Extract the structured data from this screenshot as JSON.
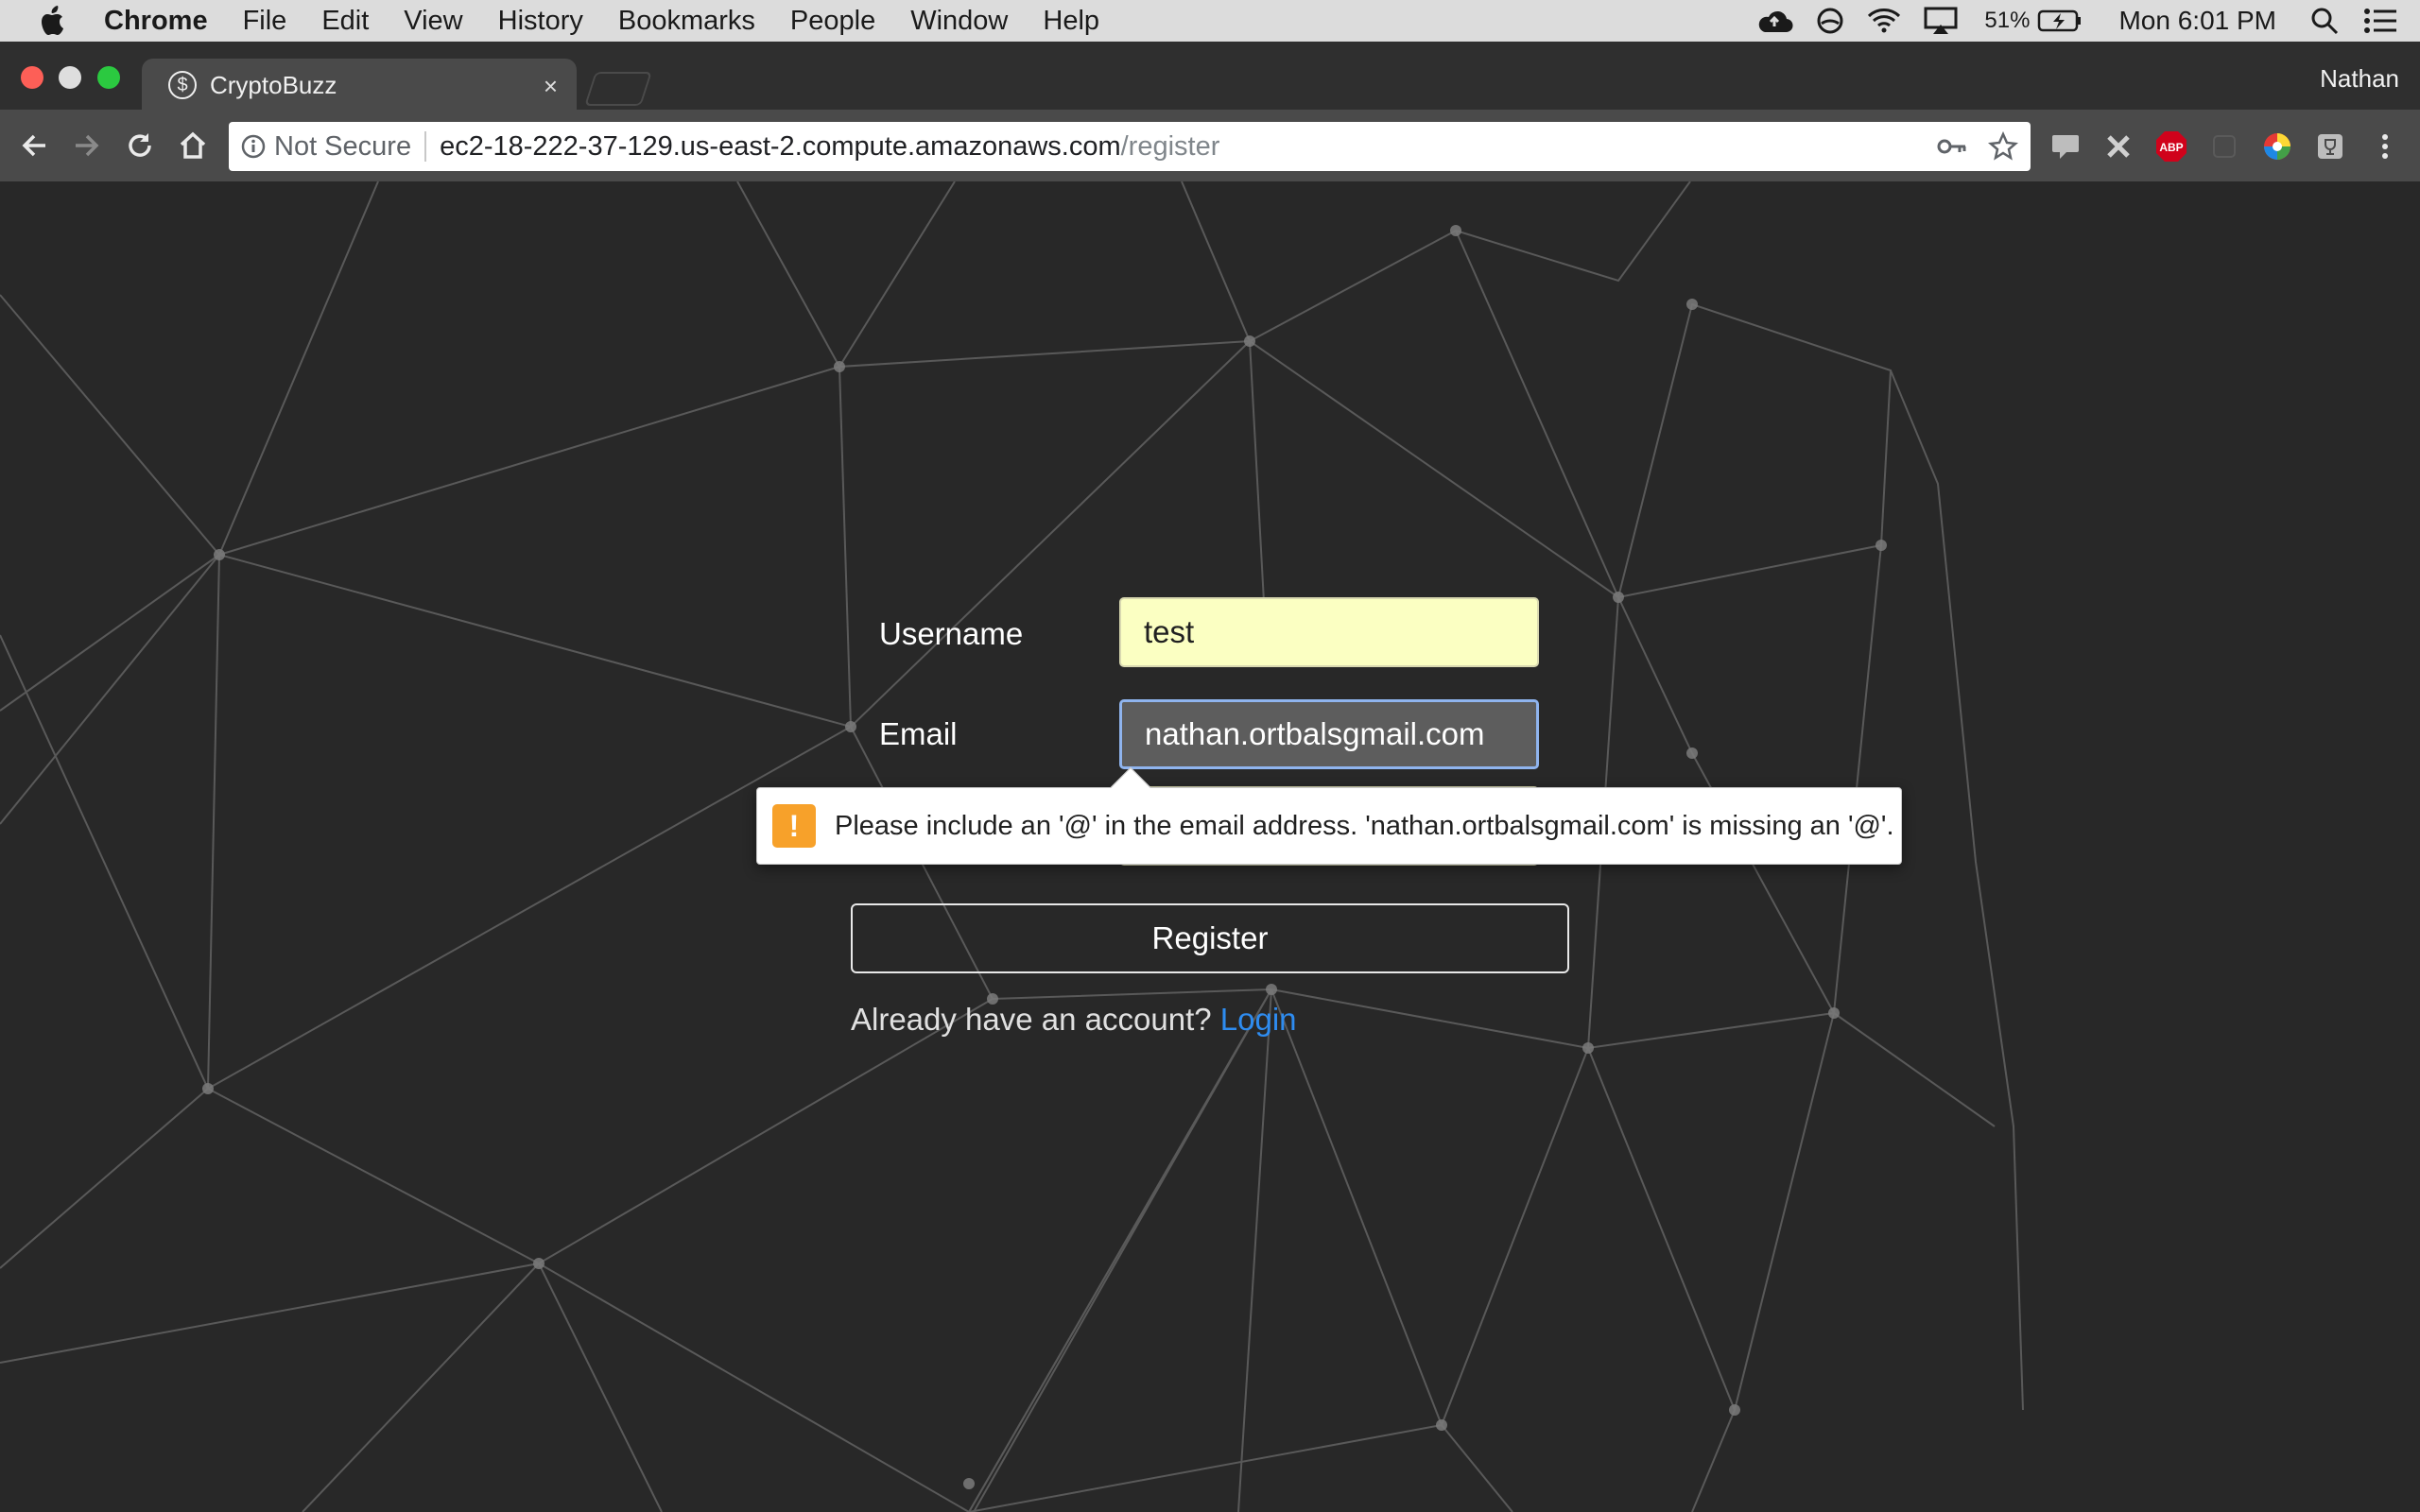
{
  "menubar": {
    "app_name": "Chrome",
    "items": [
      "File",
      "Edit",
      "View",
      "History",
      "Bookmarks",
      "People",
      "Window",
      "Help"
    ],
    "battery_percent": "51%",
    "clock": "Mon 6:01 PM"
  },
  "tab": {
    "title": "CryptoBuzz",
    "favicon_glyph": "$",
    "close_glyph": "×"
  },
  "profile_name": "Nathan",
  "omnibox": {
    "security_label": "Not Secure",
    "host": "ec2-18-222-37-129.us-east-2.compute.amazonaws.com",
    "path": "/register"
  },
  "extensions": {
    "abp_label": "ABP"
  },
  "form": {
    "username_label": "Username",
    "username_value": "test",
    "email_label": "Email",
    "email_value": "nathan.ortbalsgmail.com",
    "register_label": "Register",
    "login_prompt": "Already have an account?",
    "login_link": "Login"
  },
  "validation": {
    "icon_glyph": "!",
    "message": "Please include an '@' in the email address. 'nathan.ortbalsgmail.com' is missing an '@'."
  },
  "colors": {
    "page_bg": "#282828",
    "link": "#2e8cf0",
    "username_fill": "#fbffc2",
    "warning": "#f7a12a"
  }
}
